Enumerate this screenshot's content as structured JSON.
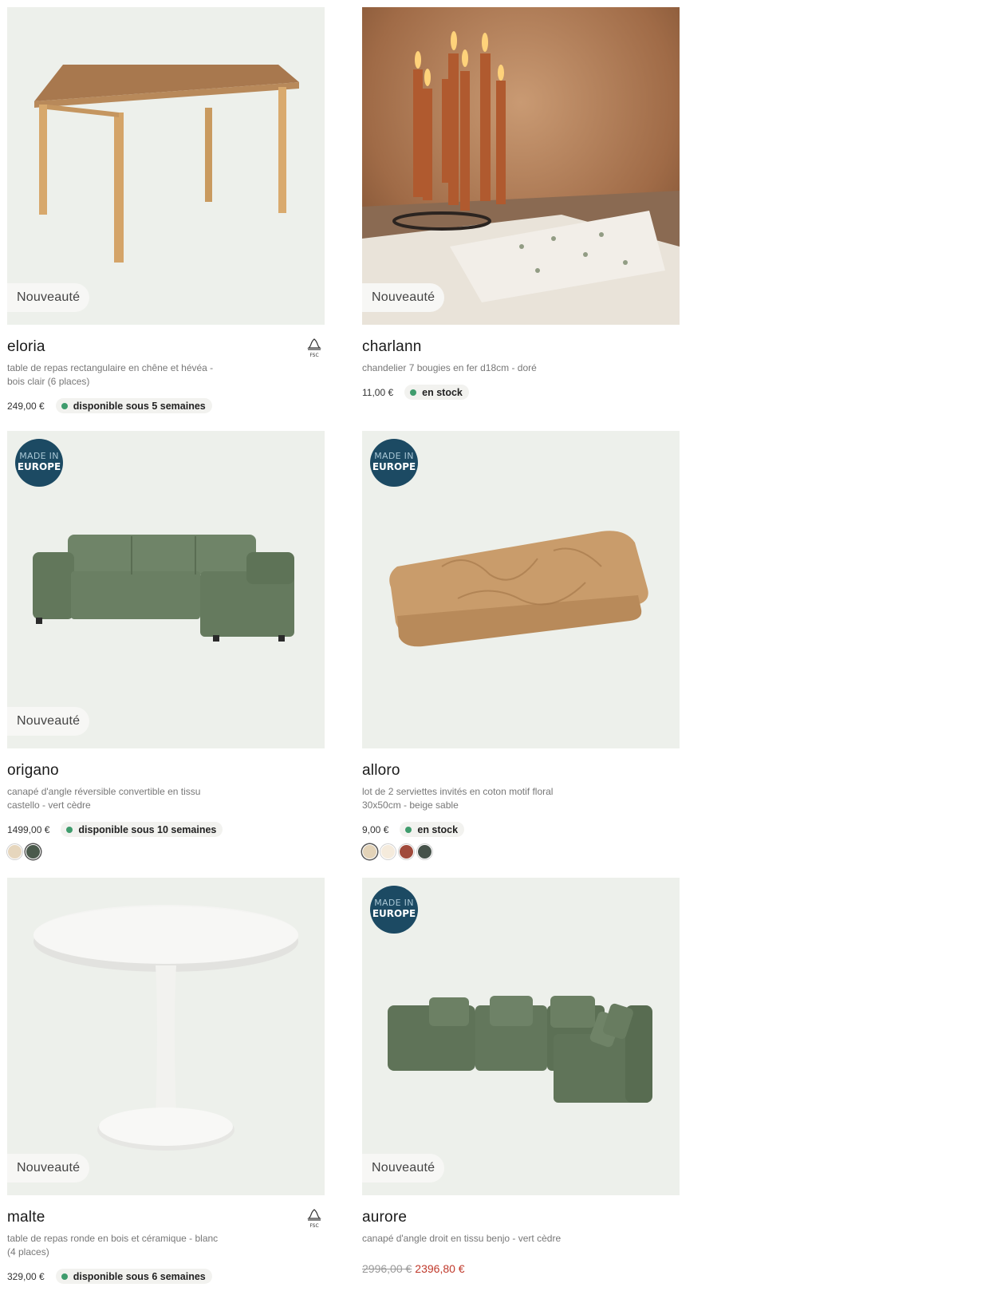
{
  "products": [
    {
      "name": "eloria",
      "description": "table de repas rectangulaire en chêne et hévéa - bois clair (6 places)",
      "badge": "Nouveauté",
      "price": "249,00 €",
      "availability": "disponible sous 5 semaines",
      "fsc": "FSC",
      "image_icon": "wooden-table-icon"
    },
    {
      "name": "charlann",
      "description": "chandelier 7 bougies en fer d18cm - doré",
      "badge": "Nouveauté",
      "price": "11,00 €",
      "availability": "en stock",
      "image_icon": "candle-holder-icon"
    },
    {
      "name": "origano",
      "description": "canapé d'angle réversible convertible en tissu castello - vert cèdre",
      "badge": "Nouveauté",
      "made_in_1": "MADE IN",
      "made_in_2": "EUROPE",
      "price": "1499,00 €",
      "availability": "disponible sous 10 semaines",
      "swatches": [
        "#e6d6bd",
        "#4a5a4c"
      ],
      "image_icon": "corner-sofa-icon"
    },
    {
      "name": "alloro",
      "description": "lot de 2 serviettes invités en coton motif floral 30x50cm - beige sable",
      "made_in_1": "MADE IN",
      "made_in_2": "EUROPE",
      "price": "9,00 €",
      "availability": "en stock",
      "swatches": [
        "#e3d3b8",
        "#f5ebdc",
        "#a04a3b",
        "#46524a"
      ],
      "image_icon": "towel-icon"
    },
    {
      "name": "malte",
      "description": "table de repas ronde en bois et céramique - blanc (4 places)",
      "badge": "Nouveauté",
      "price": "329,00 €",
      "availability": "disponible sous 6 semaines",
      "fsc": "FSC",
      "image_icon": "round-table-icon"
    },
    {
      "name": "aurore",
      "description": "canapé d'angle droit en tissu benjo - vert cèdre",
      "badge": "Nouveauté",
      "made_in_1": "MADE IN",
      "made_in_2": "EUROPE",
      "old_price": "2996,00 €",
      "sale_price": "2396,80 €",
      "image_icon": "modular-sofa-icon"
    }
  ],
  "colors": {
    "image_bg": "#edf0eb",
    "stock_dot": "#3f9c6d",
    "eu_badge": "#1c4a63",
    "sale_price": "#c0392b"
  }
}
